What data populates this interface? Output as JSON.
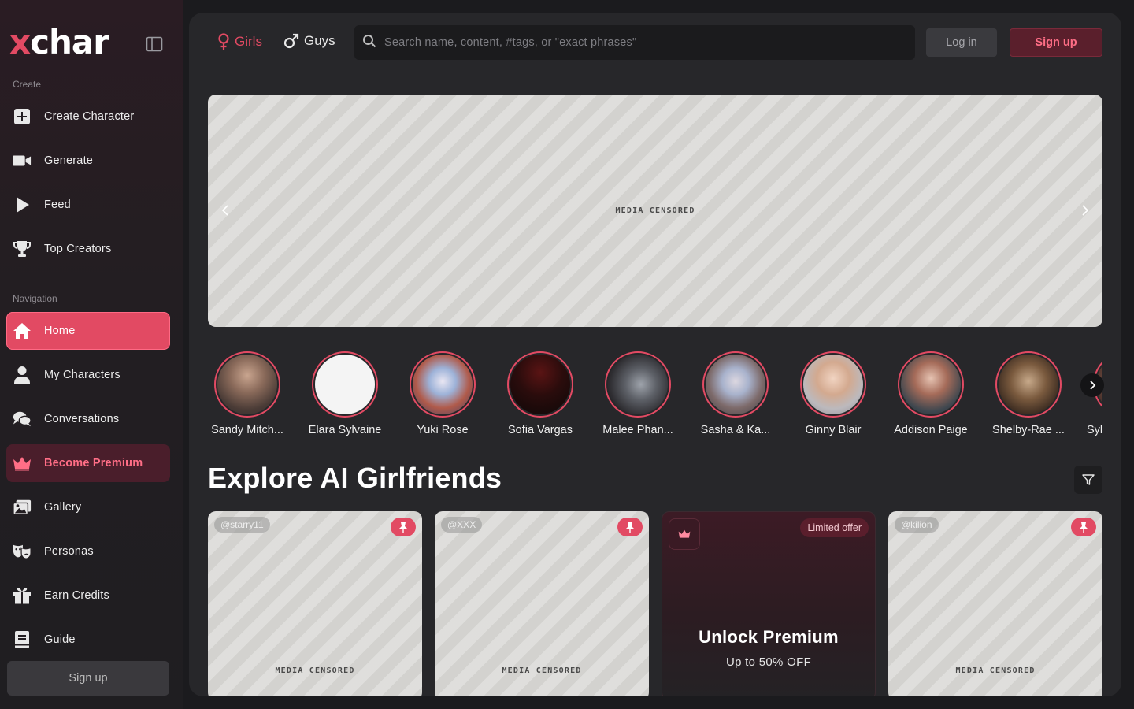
{
  "brand": {
    "logo_x": "x",
    "logo_rest": "char",
    "accent": "#e24a63"
  },
  "sidebar": {
    "create_label": "Create",
    "create_items": [
      {
        "label": "Create Character",
        "icon": "plus-square-icon"
      },
      {
        "label": "Generate",
        "icon": "video-camera-icon"
      },
      {
        "label": "Feed",
        "icon": "play-icon"
      },
      {
        "label": "Top Creators",
        "icon": "trophy-icon"
      }
    ],
    "navigation_label": "Navigation",
    "nav_items": [
      {
        "label": "Home",
        "icon": "home-icon",
        "active": true
      },
      {
        "label": "My Characters",
        "icon": "user-icon"
      },
      {
        "label": "Conversations",
        "icon": "chat-icon"
      },
      {
        "label": "Become Premium",
        "icon": "crown-icon"
      },
      {
        "label": "Gallery",
        "icon": "images-icon"
      },
      {
        "label": "Personas",
        "icon": "masks-icon"
      },
      {
        "label": "Earn Credits",
        "icon": "gift-icon"
      },
      {
        "label": "Guide",
        "icon": "book-icon"
      }
    ],
    "signup_label": "Sign up"
  },
  "header": {
    "tab_girls": "Girls",
    "tab_guys": "Guys",
    "search_placeholder": "Search name, content, #tags, or \"exact phrases\"",
    "login_label": "Log in",
    "signup_label": "Sign up"
  },
  "banner": {
    "censored_label": "MEDIA CENSORED"
  },
  "stories": [
    {
      "name": "Sandy Mitch..."
    },
    {
      "name": "Elara Sylvaine"
    },
    {
      "name": "Yuki Rose"
    },
    {
      "name": "Sofia Vargas"
    },
    {
      "name": "Malee Phan..."
    },
    {
      "name": "Sasha & Ka..."
    },
    {
      "name": "Ginny Blair"
    },
    {
      "name": "Addison Paige"
    },
    {
      "name": "Shelby-Rae ..."
    },
    {
      "name": "Syl"
    }
  ],
  "section_title": "Explore AI Girlfriends",
  "cards": [
    {
      "handle": "@starry11",
      "censored_label": "MEDIA CENSORED"
    },
    {
      "handle": "@XXX",
      "censored_label": "MEDIA CENSORED"
    },
    {
      "promo_badge": "Limited offer",
      "promo_title": "Unlock Premium",
      "promo_sub": "Up to 50% OFF"
    },
    {
      "handle": "@kilion",
      "censored_label": "MEDIA CENSORED"
    }
  ]
}
